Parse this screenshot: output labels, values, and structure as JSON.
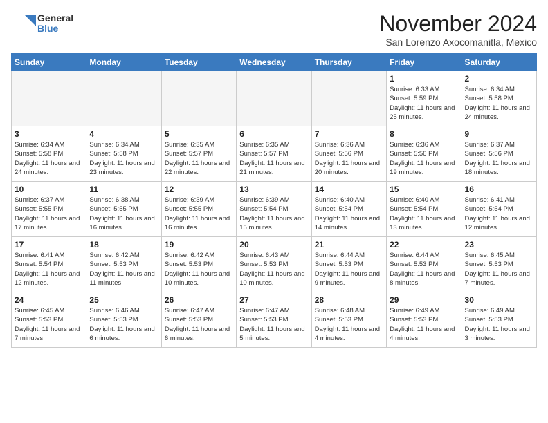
{
  "header": {
    "logo_general": "General",
    "logo_blue": "Blue",
    "month": "November 2024",
    "location": "San Lorenzo Axocomanitla, Mexico"
  },
  "weekdays": [
    "Sunday",
    "Monday",
    "Tuesday",
    "Wednesday",
    "Thursday",
    "Friday",
    "Saturday"
  ],
  "weeks": [
    [
      {
        "day": "",
        "info": ""
      },
      {
        "day": "",
        "info": ""
      },
      {
        "day": "",
        "info": ""
      },
      {
        "day": "",
        "info": ""
      },
      {
        "day": "",
        "info": ""
      },
      {
        "day": "1",
        "info": "Sunrise: 6:33 AM\nSunset: 5:59 PM\nDaylight: 11 hours and 25 minutes."
      },
      {
        "day": "2",
        "info": "Sunrise: 6:34 AM\nSunset: 5:58 PM\nDaylight: 11 hours and 24 minutes."
      }
    ],
    [
      {
        "day": "3",
        "info": "Sunrise: 6:34 AM\nSunset: 5:58 PM\nDaylight: 11 hours and 24 minutes."
      },
      {
        "day": "4",
        "info": "Sunrise: 6:34 AM\nSunset: 5:58 PM\nDaylight: 11 hours and 23 minutes."
      },
      {
        "day": "5",
        "info": "Sunrise: 6:35 AM\nSunset: 5:57 PM\nDaylight: 11 hours and 22 minutes."
      },
      {
        "day": "6",
        "info": "Sunrise: 6:35 AM\nSunset: 5:57 PM\nDaylight: 11 hours and 21 minutes."
      },
      {
        "day": "7",
        "info": "Sunrise: 6:36 AM\nSunset: 5:56 PM\nDaylight: 11 hours and 20 minutes."
      },
      {
        "day": "8",
        "info": "Sunrise: 6:36 AM\nSunset: 5:56 PM\nDaylight: 11 hours and 19 minutes."
      },
      {
        "day": "9",
        "info": "Sunrise: 6:37 AM\nSunset: 5:56 PM\nDaylight: 11 hours and 18 minutes."
      }
    ],
    [
      {
        "day": "10",
        "info": "Sunrise: 6:37 AM\nSunset: 5:55 PM\nDaylight: 11 hours and 17 minutes."
      },
      {
        "day": "11",
        "info": "Sunrise: 6:38 AM\nSunset: 5:55 PM\nDaylight: 11 hours and 16 minutes."
      },
      {
        "day": "12",
        "info": "Sunrise: 6:39 AM\nSunset: 5:55 PM\nDaylight: 11 hours and 16 minutes."
      },
      {
        "day": "13",
        "info": "Sunrise: 6:39 AM\nSunset: 5:54 PM\nDaylight: 11 hours and 15 minutes."
      },
      {
        "day": "14",
        "info": "Sunrise: 6:40 AM\nSunset: 5:54 PM\nDaylight: 11 hours and 14 minutes."
      },
      {
        "day": "15",
        "info": "Sunrise: 6:40 AM\nSunset: 5:54 PM\nDaylight: 11 hours and 13 minutes."
      },
      {
        "day": "16",
        "info": "Sunrise: 6:41 AM\nSunset: 5:54 PM\nDaylight: 11 hours and 12 minutes."
      }
    ],
    [
      {
        "day": "17",
        "info": "Sunrise: 6:41 AM\nSunset: 5:54 PM\nDaylight: 11 hours and 12 minutes."
      },
      {
        "day": "18",
        "info": "Sunrise: 6:42 AM\nSunset: 5:53 PM\nDaylight: 11 hours and 11 minutes."
      },
      {
        "day": "19",
        "info": "Sunrise: 6:42 AM\nSunset: 5:53 PM\nDaylight: 11 hours and 10 minutes."
      },
      {
        "day": "20",
        "info": "Sunrise: 6:43 AM\nSunset: 5:53 PM\nDaylight: 11 hours and 10 minutes."
      },
      {
        "day": "21",
        "info": "Sunrise: 6:44 AM\nSunset: 5:53 PM\nDaylight: 11 hours and 9 minutes."
      },
      {
        "day": "22",
        "info": "Sunrise: 6:44 AM\nSunset: 5:53 PM\nDaylight: 11 hours and 8 minutes."
      },
      {
        "day": "23",
        "info": "Sunrise: 6:45 AM\nSunset: 5:53 PM\nDaylight: 11 hours and 7 minutes."
      }
    ],
    [
      {
        "day": "24",
        "info": "Sunrise: 6:45 AM\nSunset: 5:53 PM\nDaylight: 11 hours and 7 minutes."
      },
      {
        "day": "25",
        "info": "Sunrise: 6:46 AM\nSunset: 5:53 PM\nDaylight: 11 hours and 6 minutes."
      },
      {
        "day": "26",
        "info": "Sunrise: 6:47 AM\nSunset: 5:53 PM\nDaylight: 11 hours and 6 minutes."
      },
      {
        "day": "27",
        "info": "Sunrise: 6:47 AM\nSunset: 5:53 PM\nDaylight: 11 hours and 5 minutes."
      },
      {
        "day": "28",
        "info": "Sunrise: 6:48 AM\nSunset: 5:53 PM\nDaylight: 11 hours and 4 minutes."
      },
      {
        "day": "29",
        "info": "Sunrise: 6:49 AM\nSunset: 5:53 PM\nDaylight: 11 hours and 4 minutes."
      },
      {
        "day": "30",
        "info": "Sunrise: 6:49 AM\nSunset: 5:53 PM\nDaylight: 11 hours and 3 minutes."
      }
    ]
  ]
}
